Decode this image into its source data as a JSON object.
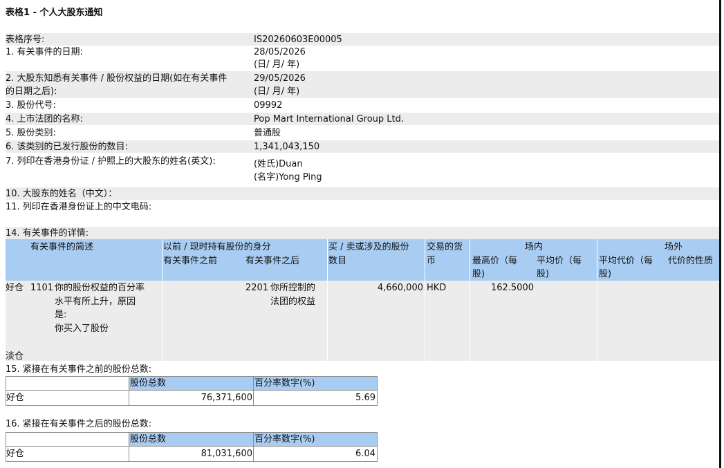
{
  "title": "表格1 - 个人大股东通知",
  "form": [
    {
      "label": "表格序号:",
      "value": "IS20260603E00005"
    },
    {
      "label": "1. 有关事件的日期:",
      "value": "28/05/2026",
      "value2": "(日/ 月/ 年)"
    },
    {
      "label": "2. 大股东知悉有关事件 / 股份权益的日期(如在有关事件",
      "label2": "的日期之后):",
      "value": "29/05/2026",
      "value2": "(日/ 月/ 年)"
    },
    {
      "label": "3. 股份代号:",
      "value": "09992"
    },
    {
      "label": "4. 上市法团的名称:",
      "value": "Pop Mart International Group Ltd."
    },
    {
      "label": "5. 股份类别:",
      "value": "普通股"
    },
    {
      "label": "6. 该类别的已发行股份的数目:",
      "value": "1,341,043,150"
    },
    {
      "label": "7. 列印在香港身份证 / 护照上的大股东的姓名(英文):",
      "value": "(姓氏)Duan",
      "value2": "(名字)Yong Ping"
    },
    {
      "label": "10. 大股东的姓名（中文）："
    },
    {
      "label": "11. 列印在香港身份证上的中文电码:"
    }
  ],
  "section14": {
    "title": "14. 有关事件的详情:",
    "headers": {
      "brief": "有关事件的简述",
      "capacity": "以前 / 现时持有股份的身分",
      "before": "有关事件之前",
      "after": "有关事件之后",
      "shares": "买 / 卖或涉及的股份",
      "shares2": "数目",
      "currency": "交易的货",
      "currency2": "币",
      "onexchange": "场内",
      "highest": "最高价（每",
      "highest2": "股)",
      "average": "平均价（每",
      "average2": "股)",
      "offexchange": "场外",
      "offavg": "平均代价（每",
      "offavg2": "股)",
      "nature": "代价的性质"
    },
    "row": {
      "position": "好仓",
      "code": "1101",
      "brief": [
        "你的股份权益的百分率",
        "水平有所上升，原因",
        "是:",
        "你买入了股份"
      ],
      "after_code": "2201",
      "after": [
        "你所控制的",
        "法团的权益"
      ],
      "shares": "4,660,000",
      "currency": "HKD",
      "highest": "162.5000"
    },
    "short_label": "淡仓"
  },
  "section15": {
    "title": "15. 紧接在有关事件之前的股份总数:",
    "col1": "股份总数",
    "col2": "百分率数字(%)",
    "position": "好仓",
    "shares": "76,371,600",
    "percent": "5.69"
  },
  "section16": {
    "title": "16. 紧接在有关事件之后的股份总数:",
    "col1": "股份总数",
    "col2": "百分率数字(%)",
    "position": "好仓",
    "shares": "81,031,600",
    "percent": "6.04"
  }
}
